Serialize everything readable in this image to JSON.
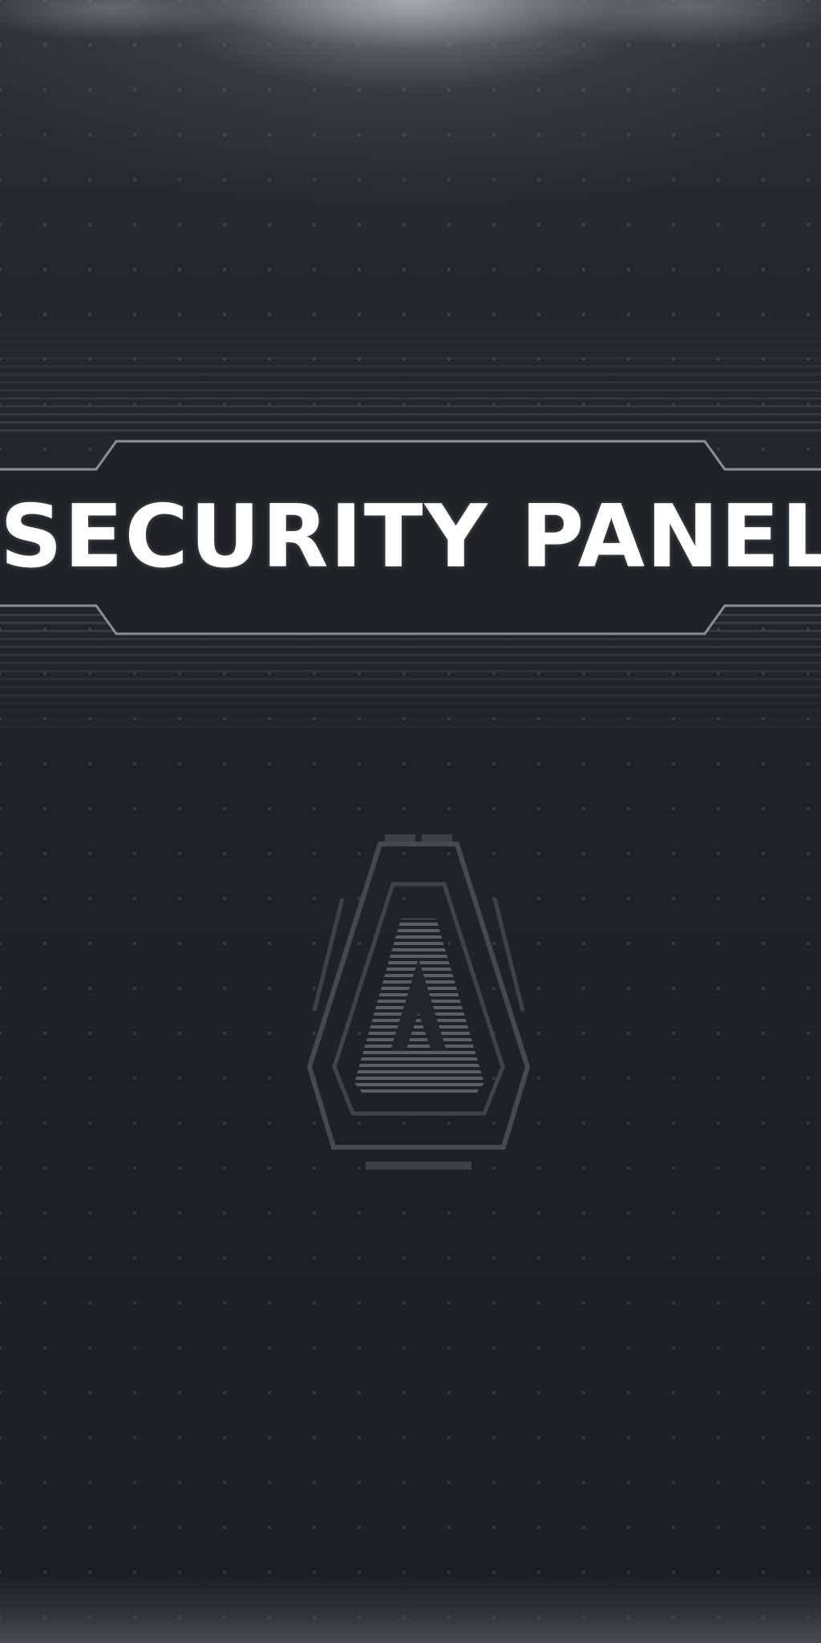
{
  "screen": {
    "title": "SECURITY PANEL"
  },
  "emblem": {
    "icon": "a-emblem-icon"
  },
  "colors": {
    "background": "#1c2024",
    "title_text": "#ffffff",
    "frame_line": "#8a9096",
    "banner_fill": "#1e2327",
    "emblem_stroke": "#4a4f54"
  }
}
